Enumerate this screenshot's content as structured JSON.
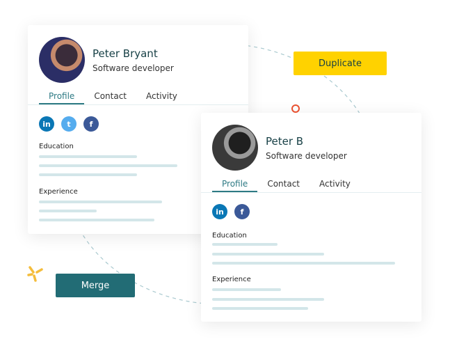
{
  "actions": {
    "duplicate_label": "Duplicate",
    "merge_label": "Merge"
  },
  "colors": {
    "accent": "#2e7a84",
    "duplicate_bg": "#ffd200",
    "merge_bg": "#226c75",
    "marker": "#e8502f",
    "spark": "#f4bd3c"
  },
  "cards": [
    {
      "name": "Peter Bryant",
      "role": "Software developer",
      "tabs": [
        "Profile",
        "Contact",
        "Activity"
      ],
      "active_tab": "Profile",
      "social": [
        "linkedin-icon",
        "twitter-icon",
        "facebook-icon"
      ],
      "sections": [
        "Education",
        "Experience"
      ]
    },
    {
      "name": "Peter B",
      "role": "Software developer",
      "tabs": [
        "Profile",
        "Contact",
        "Activity"
      ],
      "active_tab": "Profile",
      "social": [
        "linkedin-icon",
        "facebook-icon"
      ],
      "sections": [
        "Education",
        "Experience"
      ]
    }
  ]
}
